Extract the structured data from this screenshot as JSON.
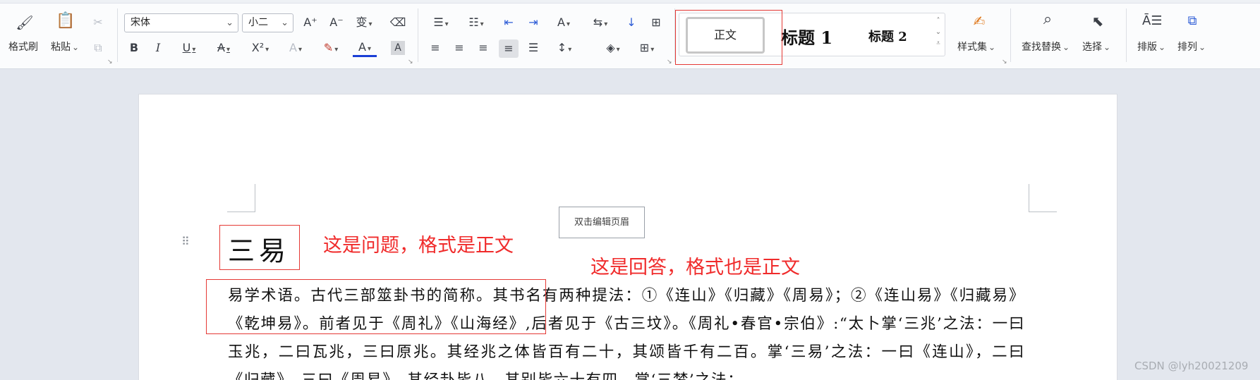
{
  "ribbon": {
    "clipboard": {
      "format_painter_label": "格式刷",
      "paste_label": "粘贴"
    },
    "font": {
      "font_name": "宋体",
      "font_size": "小二",
      "font_color": "#1a3fd6",
      "bold": "B",
      "italic": "I",
      "underline": "U",
      "superscript": "X²"
    },
    "styles": {
      "normal": "正文",
      "heading1": "标题 1",
      "heading2": "标题 2",
      "style_set_label": "样式集"
    },
    "editing": {
      "find_replace_label": "查找替换",
      "select_label": "选择"
    },
    "arrange": {
      "layout_label": "排版",
      "arrange_label": "排列"
    }
  },
  "document": {
    "header_tip": "双击编辑页眉",
    "title": "三易",
    "body": "易学术语。古代三部筮卦书的简称。其书名有两种提法：①《连山》《归藏》《周易》；②《连山易》《归藏易》《乾坤易》。前者见于《周礼》《山海经》,后者见于《古三坟》。《周礼•春官•宗伯》:“太卜掌‘三兆’之法：一曰玉兆，二曰瓦兆，三曰原兆。其经兆之体皆百有二十，其颂皆千有二百。掌‘三易’之法：一曰《连山》，二曰《归藏》，三曰《周易》。其经卦皆八，其别皆六十有四。掌‘三梦’之法："
  },
  "annotations": {
    "question_note": "这是问题，格式是正文",
    "answer_note": "这是回答，格式也是正文",
    "color": "#f02b2b"
  },
  "watermark": "CSDN @lyh20021209"
}
